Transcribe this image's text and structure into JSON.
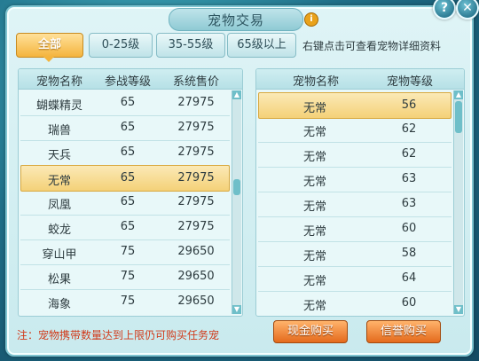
{
  "window": {
    "title": "宠物交易",
    "info_icon": "i",
    "help_icon": "?",
    "close_icon": "✕"
  },
  "filters": [
    {
      "label": "全部"
    },
    {
      "label": "0-25级"
    },
    {
      "label": "35-55级"
    },
    {
      "label": "65级以上"
    }
  ],
  "hint": "右键点击可查看宠物详细资料",
  "left_list": {
    "headers": [
      "宠物名称",
      "参战等级",
      "系统售价"
    ],
    "rows": [
      {
        "name": "蝴蝶精灵",
        "level": "65",
        "price": "27975"
      },
      {
        "name": "瑞兽",
        "level": "65",
        "price": "27975"
      },
      {
        "name": "天兵",
        "level": "65",
        "price": "27975"
      },
      {
        "name": "无常",
        "level": "65",
        "price": "27975"
      },
      {
        "name": "凤凰",
        "level": "65",
        "price": "27975"
      },
      {
        "name": "蛟龙",
        "level": "65",
        "price": "27975"
      },
      {
        "name": "穿山甲",
        "level": "75",
        "price": "29650"
      },
      {
        "name": "松果",
        "level": "75",
        "price": "29650"
      },
      {
        "name": "海象",
        "level": "75",
        "price": "29650"
      }
    ]
  },
  "right_list": {
    "headers": [
      "宠物名称",
      "宠物等级"
    ],
    "rows": [
      {
        "name": "无常",
        "level": "56"
      },
      {
        "name": "无常",
        "level": "62"
      },
      {
        "name": "无常",
        "level": "62"
      },
      {
        "name": "无常",
        "level": "63"
      },
      {
        "name": "无常",
        "level": "63"
      },
      {
        "name": "无常",
        "level": "60"
      },
      {
        "name": "无常",
        "level": "58"
      },
      {
        "name": "无常",
        "level": "64"
      },
      {
        "name": "无常",
        "level": "60"
      }
    ]
  },
  "note": "注：宠物携带数量达到上限仍可购买任务宠",
  "buttons": {
    "cash": "现金购买",
    "credit": "信誉购买"
  }
}
